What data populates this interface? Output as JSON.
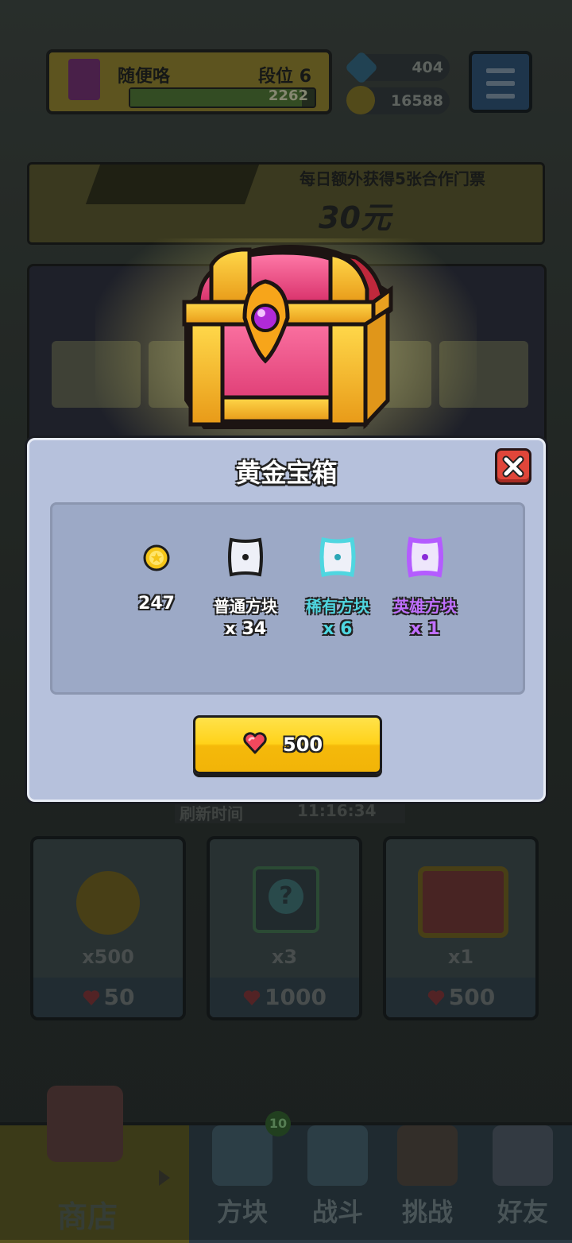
{
  "player": {
    "name": "随便咯",
    "rank_label": "段位 6",
    "score": "2262",
    "progress": 0.93
  },
  "currencies": {
    "gems": "404",
    "coins": "16588"
  },
  "banner": {
    "text": "每日额外获得5张合作门票",
    "price": "30元"
  },
  "shop": {
    "refresh_label": "刷新时间",
    "refresh_time": "11:16:34",
    "cards": [
      {
        "qty": "x500",
        "price": "50"
      },
      {
        "qty": "x3",
        "price": "1000"
      },
      {
        "qty": "x1",
        "price": "500"
      }
    ]
  },
  "nav": {
    "tabs": [
      {
        "label": "商店"
      },
      {
        "label": "方块"
      },
      {
        "label": "战斗"
      },
      {
        "label": "挑战"
      },
      {
        "label": "好友"
      }
    ],
    "notification_count": "10"
  },
  "dialog": {
    "title": "黄金宝箱",
    "rewards": [
      {
        "name": "",
        "amount": "247",
        "icon": "coin-icon"
      },
      {
        "name": "普通方块",
        "amount": "x 34",
        "icon": "common-block-icon",
        "color": "#ffffff"
      },
      {
        "name": "稀有方块",
        "amount": "x 6",
        "icon": "rare-block-icon",
        "color": "#4fd6e0"
      },
      {
        "name": "英雄方块",
        "amount": "x 1",
        "icon": "epic-block-icon",
        "color": "#b45cff"
      }
    ],
    "buy_price": "500"
  },
  "colors": {
    "dialog_bg": "#b6c1dc",
    "button_yellow": "#ffd21a",
    "close_red": "#e0463a",
    "rare_cyan": "#4fd6e0",
    "epic_purple": "#b45cff"
  }
}
